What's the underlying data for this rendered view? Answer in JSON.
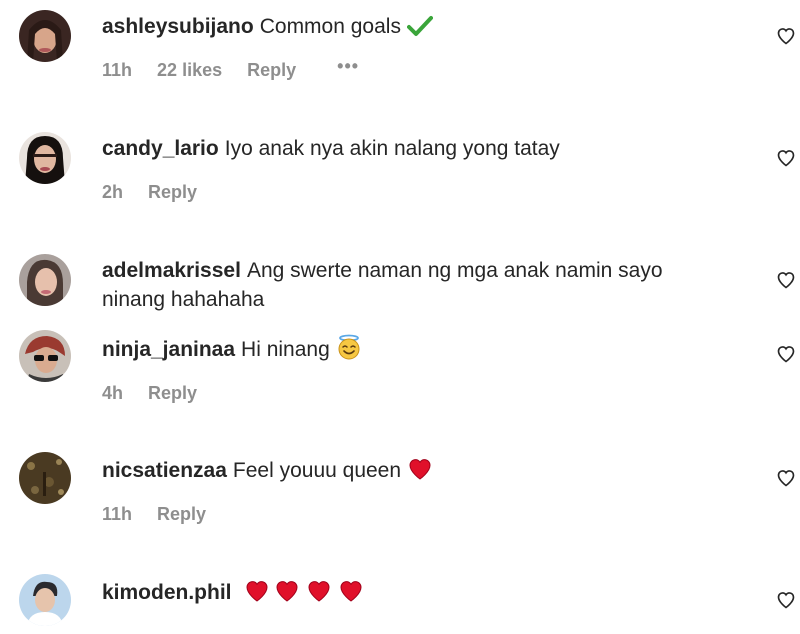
{
  "comments": [
    {
      "username": "ashleysubijano",
      "text": "Common goals",
      "emoji": "check-mark-icon",
      "time": "11h",
      "likes": "22 likes",
      "reply": "Reply",
      "more": "•••"
    },
    {
      "username": "candy_lario",
      "text": "Iyo anak nya akin nalang yong tatay",
      "time": "2h",
      "reply": "Reply"
    },
    {
      "username": "adelmakrissel",
      "text": "Ang swerte naman ng mga anak namin sayo ninang hahahaha"
    },
    {
      "username": "ninja_janinaa",
      "text": "Hi ninang",
      "emoji": "smiling-face-with-halo-icon",
      "time": "4h",
      "reply": "Reply"
    },
    {
      "username": "nicsatienzaa",
      "text": "Feel youuu queen",
      "emoji": "red-heart-icon",
      "time": "11h",
      "reply": "Reply"
    },
    {
      "username": "kimoden.phil",
      "text": "",
      "emoji": "red-heart-icon x4"
    }
  ],
  "colors": {
    "text": "#262626",
    "meta": "#8e8e8e",
    "heart": "#e0102a",
    "check": "#3aa53a"
  }
}
